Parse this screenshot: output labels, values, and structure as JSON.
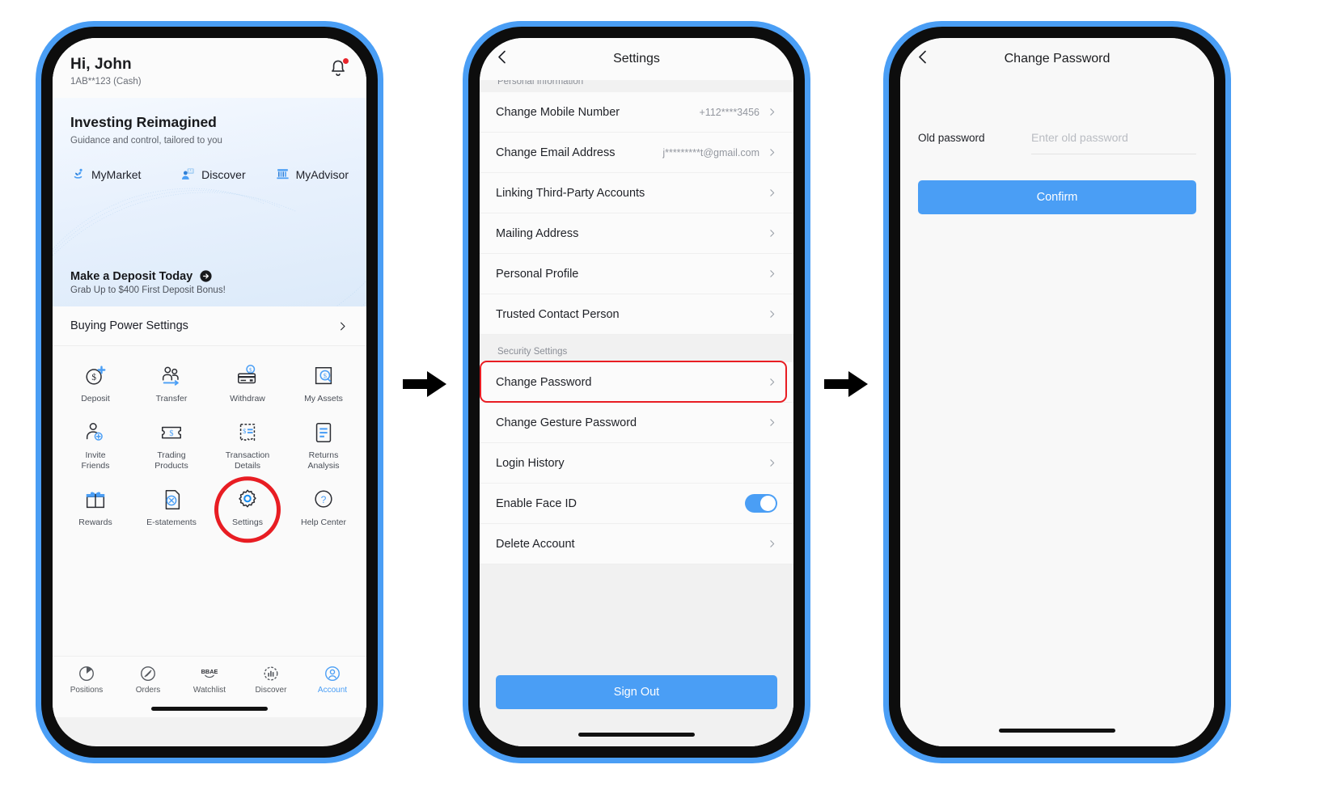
{
  "colors": {
    "frame_blue": "#4A9EF5",
    "accent_blue": "#4A9EF5",
    "highlight_red": "#E81D23",
    "bezel_black": "#0D0D0D"
  },
  "phone1": {
    "header": {
      "greeting": "Hi, John",
      "account": "1AB**123 (Cash)",
      "bell_icon": "bell-icon"
    },
    "banner": {
      "title": "Investing Reimagined",
      "subtitle": "Guidance and control, tailored to you",
      "quick_links": [
        {
          "label": "MyMarket",
          "icon": "market-plant-icon"
        },
        {
          "label": "Discover",
          "icon": "discover-person-icon"
        },
        {
          "label": "MyAdvisor",
          "icon": "advisor-chart-icon"
        }
      ],
      "deposit_title": "Make a Deposit Today",
      "deposit_sub": "Grab Up to $400 First Deposit Bonus!",
      "deposit_arrow_icon": "arrow-right-circle-icon"
    },
    "buying_power": {
      "label": "Buying Power Settings",
      "chevron": "chevron-right-icon"
    },
    "grid": [
      {
        "label": "Deposit",
        "icon": "dollar-plus-icon"
      },
      {
        "label": "Transfer",
        "icon": "people-transfer-icon"
      },
      {
        "label": "Withdraw",
        "icon": "card-dollar-icon"
      },
      {
        "label": "My Assets",
        "icon": "assets-dollar-icon"
      },
      {
        "label": "Invite\nFriends",
        "icon": "person-plus-icon"
      },
      {
        "label": "Trading\nProducts",
        "icon": "ticket-dollar-icon"
      },
      {
        "label": "Transaction\nDetails",
        "icon": "receipt-icon"
      },
      {
        "label": "Returns\nAnalysis",
        "icon": "document-lines-icon"
      },
      {
        "label": "Rewards",
        "icon": "gift-icon"
      },
      {
        "label": "E-statements",
        "icon": "statement-icon"
      },
      {
        "label": "Settings",
        "icon": "gear-icon",
        "highlighted": true
      },
      {
        "label": "Help Center",
        "icon": "question-circle-icon"
      }
    ],
    "tabbar": [
      {
        "label": "Positions",
        "icon": "pie-chart-icon",
        "active": false
      },
      {
        "label": "Orders",
        "icon": "orders-slash-icon",
        "active": false
      },
      {
        "label": "Watchlist",
        "icon": "bbae-watchlist-icon",
        "active": false
      },
      {
        "label": "Discover",
        "icon": "discover-compass-icon",
        "active": false
      },
      {
        "label": "Account",
        "icon": "person-circle-icon",
        "active": true
      }
    ]
  },
  "phone2": {
    "nav": {
      "title": "Settings",
      "back_icon": "chevron-left-icon"
    },
    "section_personal": "Personal Information",
    "section_security": "Security Settings",
    "rows_personal": [
      {
        "label": "Change Mobile Number",
        "value": "+112****3456",
        "chevron": true
      },
      {
        "label": "Change Email Address",
        "value": "j*********t@gmail.com",
        "chevron": true
      },
      {
        "label": "Linking Third-Party Accounts",
        "value": "",
        "chevron": true
      },
      {
        "label": "Mailing Address",
        "value": "",
        "chevron": true
      },
      {
        "label": "Personal Profile",
        "value": "",
        "chevron": true
      },
      {
        "label": "Trusted Contact Person",
        "value": "",
        "chevron": true
      }
    ],
    "rows_security": [
      {
        "label": "Change Password",
        "value": "",
        "chevron": true,
        "highlighted": true
      },
      {
        "label": "Change Gesture Password",
        "value": "",
        "chevron": true
      },
      {
        "label": "Login History",
        "value": "",
        "chevron": true
      },
      {
        "label": "Enable Face ID",
        "value": "",
        "toggle": true,
        "toggle_on": true
      },
      {
        "label": "Delete Account",
        "value": "",
        "chevron": true
      }
    ],
    "sign_out": "Sign Out"
  },
  "phone3": {
    "nav": {
      "title": "Change Password",
      "back_icon": "chevron-left-icon"
    },
    "old_password_label": "Old password",
    "old_password_placeholder": "Enter old password",
    "old_password_value": "",
    "confirm": "Confirm"
  },
  "flow": {
    "arrow1_icon": "arrow-right-icon",
    "arrow2_icon": "arrow-right-icon"
  }
}
